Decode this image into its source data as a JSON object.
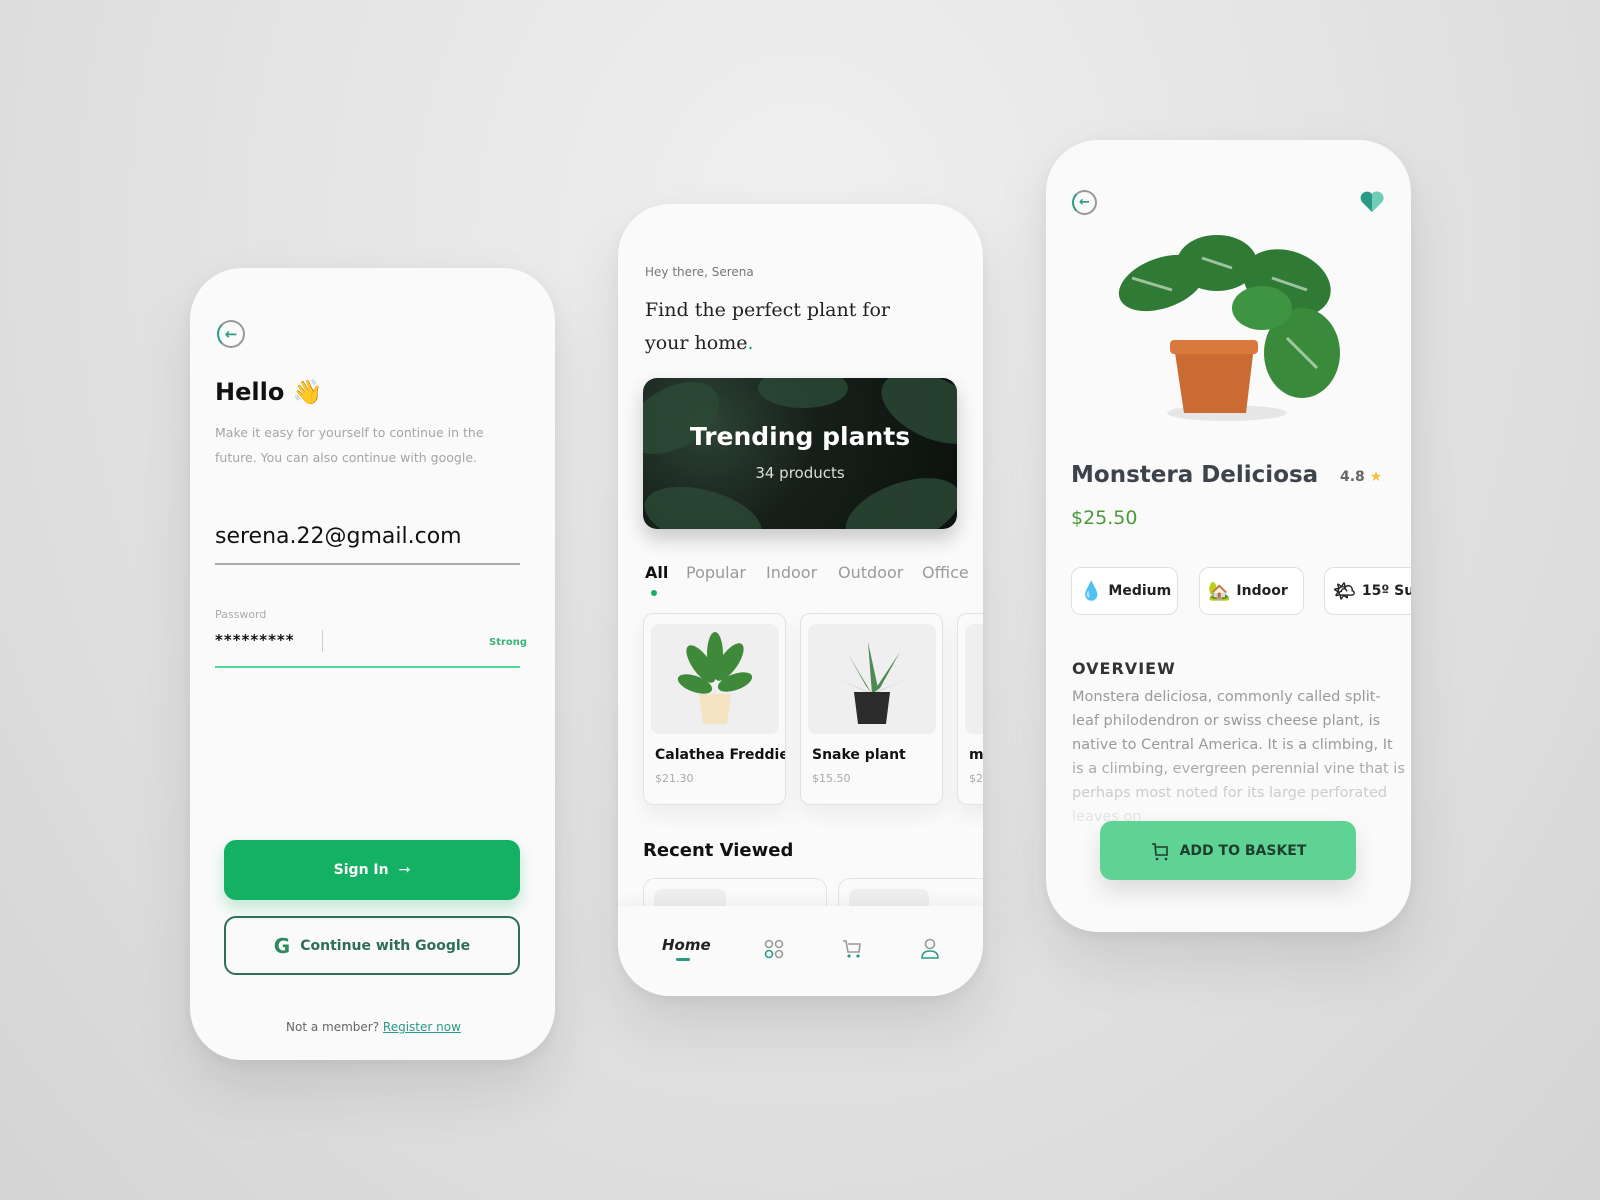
{
  "login": {
    "greeting": "Hello",
    "wave": "👋",
    "description_1": "Make it easy for yourself to continue in the",
    "description_2": "future. You can also continue with google.",
    "email_value": "serena.22@gmail.com",
    "password_label": "Password",
    "password_value": "*********",
    "strength": "Strong",
    "sign_in": "Sign In",
    "google": "Continue with Google",
    "not_member": "Not a member?",
    "register": "Register now"
  },
  "home": {
    "greeting": "Hey there, Serena",
    "title_1": "Find the perfect plant for",
    "title_2": "your home",
    "title_dot": ".",
    "banner_title": "Trending plants",
    "banner_sub": "34 products",
    "tabs": [
      "All",
      "Popular",
      "Indoor",
      "Outdoor",
      "Office"
    ],
    "active_tab": "All",
    "products": [
      {
        "name": "Calathea Freddie",
        "price": "$21.30"
      },
      {
        "name": "Snake plant",
        "price": "$15.50"
      },
      {
        "name": "m",
        "price": "$2"
      }
    ],
    "recent_title": "Recent Viewed",
    "nav": {
      "home": "Home",
      "icons": [
        "grid-icon",
        "cart-icon",
        "user-icon"
      ]
    }
  },
  "detail": {
    "name": "Monstera Deliciosa",
    "rating": "4.8",
    "price": "$25.50",
    "chips": [
      {
        "icon": "water-drops-icon",
        "label": "Medium"
      },
      {
        "icon": "house-icon",
        "label": "Indoor"
      },
      {
        "icon": "sun-cloud-icon",
        "label": "15º Su"
      }
    ],
    "overview_title": "OVERVIEW",
    "overview_lines": [
      "Monstera deliciosa, commonly called split-",
      "leaf philodendron or swiss cheese plant, is",
      "native to Central America. It is a climbing,  It",
      "is a climbing, evergreen perennial vine that is",
      "perhaps most noted for its large perforated",
      "leaves on"
    ],
    "add_button": "ADD TO BASKET"
  },
  "colors": {
    "primary_green": "#14b064",
    "button_light": "#5fd394",
    "teal": "#2a9a85",
    "price_green": "#4a9a3a"
  }
}
